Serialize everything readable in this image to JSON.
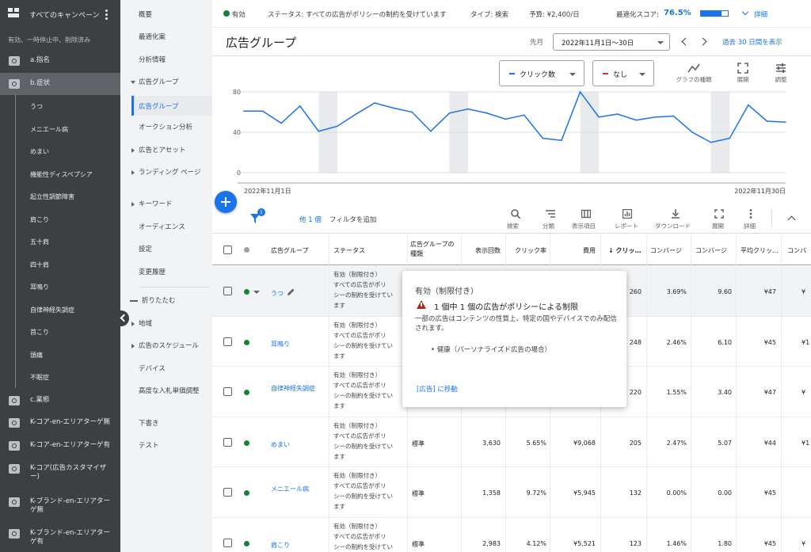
{
  "sidebar": {
    "title": "すべてのキャンペーン",
    "filter": "有効、一時停止中、削除済み",
    "campaigns": [
      {
        "label": "a.指名"
      },
      {
        "label": "b.症状"
      },
      {
        "label": "c.業態"
      },
      {
        "label": "K-コア-en-エリアターゲ無"
      },
      {
        "label": "K-コア-en-エリアターゲ有"
      },
      {
        "label": "K-コア(広告カスタマイザー)"
      },
      {
        "label": "K-ブランド-en-エリアターゲ無"
      },
      {
        "label": "K-ブランド-en-エリアターゲ有"
      }
    ],
    "adgroups": [
      "うつ",
      "メニエール病",
      "めまい",
      "機能性ディスペプシア",
      "起立性調節障害",
      "肩こり",
      "五十肩",
      "四十肩",
      "耳鳴り",
      "自律神経失調症",
      "首こり",
      "頭痛",
      "不眠症"
    ]
  },
  "nav": {
    "items": [
      "概要",
      "最適化案",
      "分析情報",
      "広告グループ",
      "広告グループ",
      "オークション分析",
      "広告とアセット",
      "ランディング ページ",
      "キーワード",
      "オーディエンス",
      "設定",
      "変更履歴",
      "折りたたむ",
      "地域",
      "広告のスケジュール",
      "デバイス",
      "高度な入札単価調整",
      "下書き",
      "テスト"
    ]
  },
  "topbar": {
    "status_label": "有効",
    "status_text": "ステータス: すべての広告がポリシーの制約を受けています",
    "type_text": "タイプ: 検索",
    "budget_text": "予算: ¥2,400/日",
    "score_label": "最適化スコア:",
    "score_value": "76.5%",
    "score_fraction": 0.765,
    "details": "詳細"
  },
  "header": {
    "title": "広告グループ",
    "period_label": "先月",
    "date_range": "2022年11月1日～30日",
    "show_30": "過去 30 日間を表示"
  },
  "chart_controls": {
    "metric1": "クリック数",
    "metric2": "なし",
    "graph_type": "グラフの種類",
    "expand": "展開",
    "adjust": "調整"
  },
  "chart_data": {
    "type": "line",
    "ylim": [
      0,
      80
    ],
    "yticks": [
      "80",
      "40",
      "0"
    ],
    "x_start_label": "2022年11月1日",
    "x_end_label": "2022年11月30日",
    "series": [
      {
        "values": [
          61,
          61,
          49,
          66,
          41,
          46,
          58,
          69,
          64,
          60,
          41,
          59,
          63,
          59,
          53,
          57,
          34,
          32,
          80,
          55,
          58,
          52,
          55,
          56,
          40,
          30,
          34,
          67,
          51,
          50
        ],
        "color": "#1a73e8"
      }
    ]
  },
  "toolbar": {
    "filter_badge": "1",
    "other": "他 1 個",
    "add_filter": "フィルタを追加",
    "search": "検索",
    "segment": "分類",
    "columns": "表示項目",
    "report": "レポート",
    "download": "ダウンロード",
    "expand": "展開",
    "details": "詳細"
  },
  "table": {
    "headers": [
      "広告グループ",
      "ステータス",
      "広告グループの種類",
      "表示回数",
      "クリック率",
      "費用",
      "クリッ…",
      "コンバージ",
      "コンバージ",
      "平均クリッ…",
      "コンバ"
    ],
    "status_lines": [
      "有効（制限付き）",
      "すべての広告がポリ",
      "シーの制約を受けてい",
      "ます"
    ],
    "rows": [
      {
        "name": "うつ",
        "type": "",
        "impr": "",
        "ctr": "",
        "cost": "",
        "clicks": "260",
        "cvr": "3.69%",
        "conv": "9.60",
        "cpc": "¥47",
        "more": "¥"
      },
      {
        "name": "耳鳴り",
        "type": "",
        "impr": "",
        "ctr": "",
        "cost": "",
        "clicks": "248",
        "cvr": "2.46%",
        "conv": "6.10",
        "cpc": "¥45",
        "more": "¥1"
      },
      {
        "name": "自律神経失調症",
        "type": "",
        "impr": "",
        "ctr": "",
        "cost": "",
        "clicks": "220",
        "cvr": "1.55%",
        "conv": "3.40",
        "cpc": "¥47",
        "more": "¥"
      },
      {
        "name": "めまい",
        "type": "標準",
        "impr": "3,630",
        "ctr": "5.65%",
        "cost": "¥9,068",
        "clicks": "205",
        "cvr": "2.47%",
        "conv": "5.07",
        "cpc": "¥44",
        "more": "¥1"
      },
      {
        "name": "メニエール病",
        "type": "標準",
        "impr": "1,358",
        "ctr": "9.72%",
        "cost": "¥5,945",
        "clicks": "132",
        "cvr": "0.00%",
        "conv": "0.00",
        "cpc": "¥45",
        "more": ""
      },
      {
        "name": "肩こり",
        "type": "標準",
        "impr": "2,983",
        "ctr": "4.12%",
        "cost": "¥5,521",
        "clicks": "123",
        "cvr": "1.46%",
        "conv": "1.80",
        "cpc": "¥45",
        "more": "¥"
      }
    ]
  },
  "tooltip": {
    "title": "有効（制限付き）",
    "warning": "1 個中 1 個の広告がポリシーによる制限",
    "body": "一部の広告はコンテンツの性質上、特定の国やデバイスでのみ配信されます。",
    "bullet": "• 健康（パーソナライズド広告の場合）",
    "link": "[広告] に移動"
  }
}
